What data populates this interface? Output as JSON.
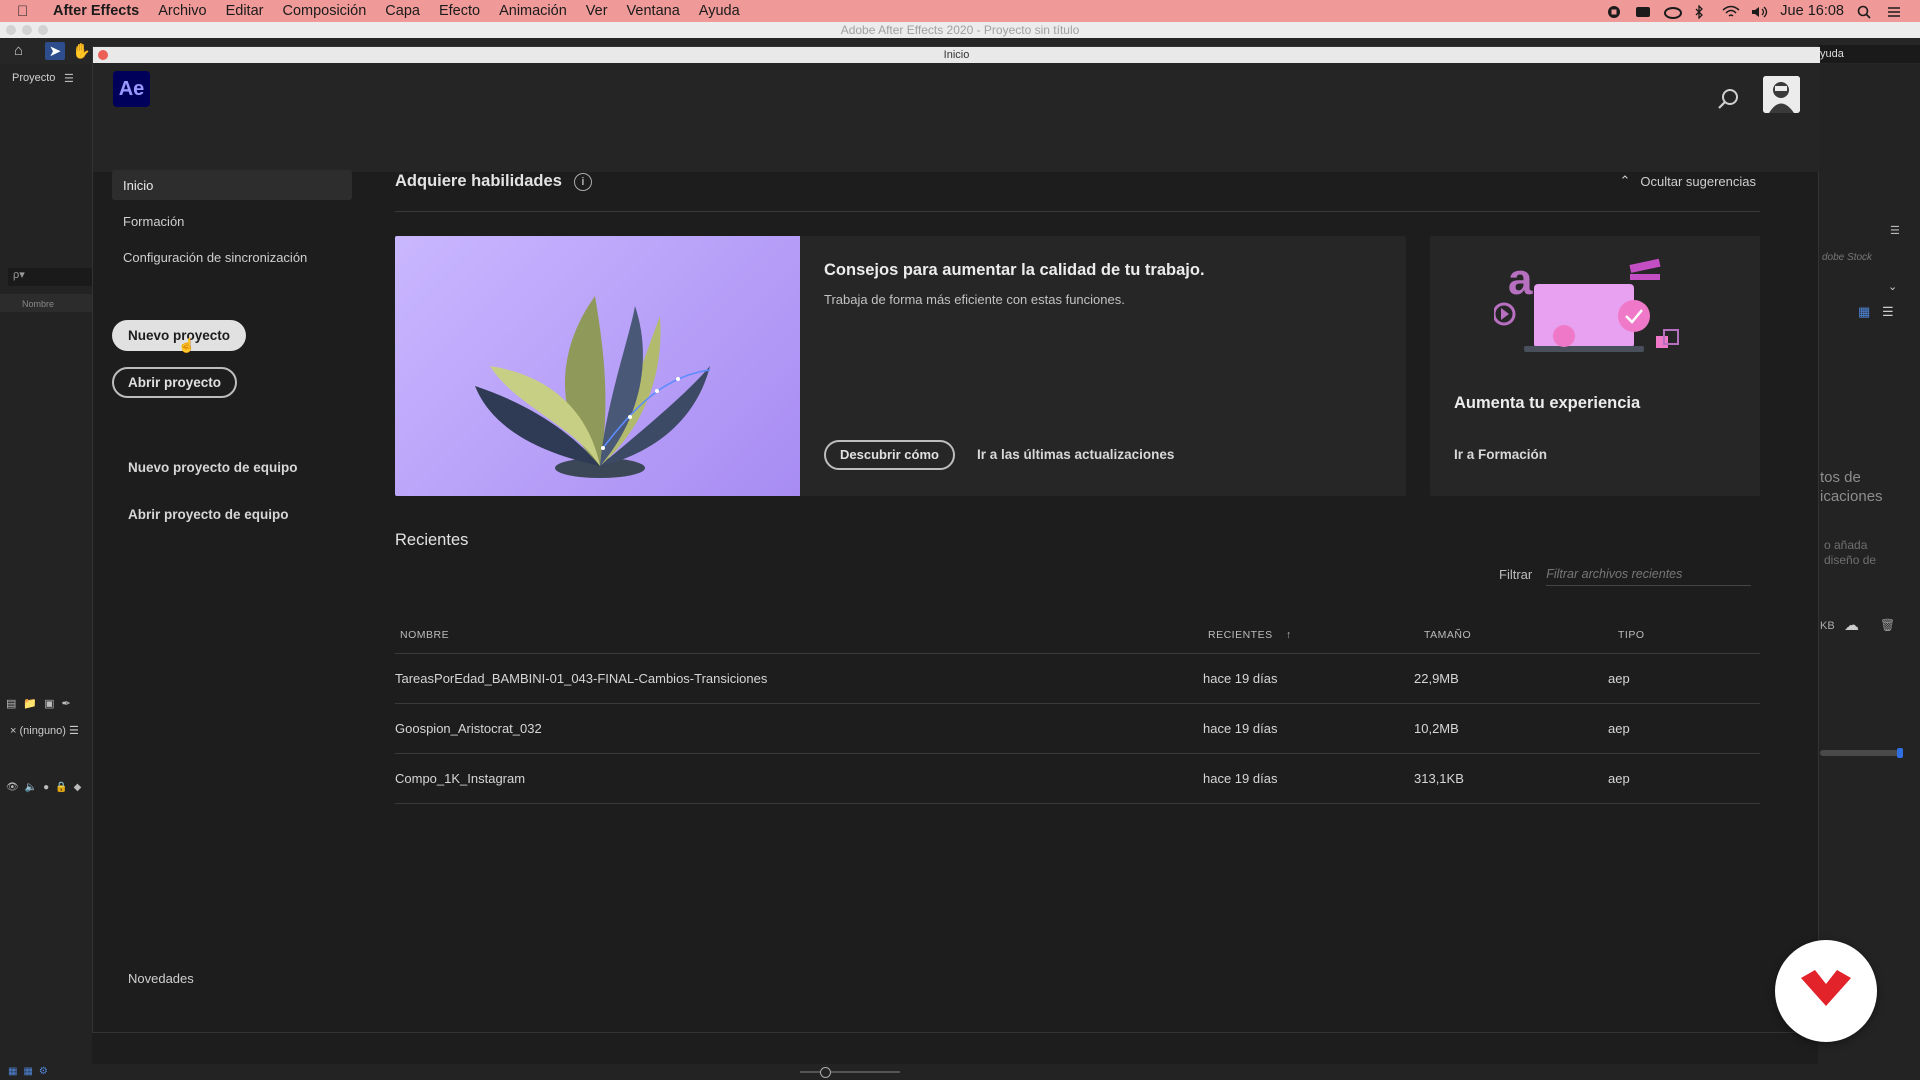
{
  "menubar": {
    "app_name": "After Effects",
    "items": [
      "Archivo",
      "Editar",
      "Composición",
      "Capa",
      "Efecto",
      "Animación",
      "Ver",
      "Ventana",
      "Ayuda"
    ],
    "clock": "Jue 16:08"
  },
  "window_title": "Adobe After Effects 2020 - Proyecto sin título",
  "background": {
    "project_panel_title": "Proyecto",
    "search_placeholder": "ρ▾",
    "name_column": "Nombre",
    "none_label": "(ninguno)",
    "help_tab": "yuda",
    "stock_label": "dobe Stock",
    "right_text_1": "tos de\nicaciones",
    "right_text_2": "o añada\ndiseño de",
    "kb_label": "KB"
  },
  "home": {
    "window_title": "Inicio",
    "logo_text": "Ae",
    "nav": [
      "Inicio",
      "Formación",
      "Configuración de sincronización"
    ],
    "new_project": "Nuevo proyecto",
    "open_project": "Abrir proyecto",
    "new_team_project": "Nuevo proyecto de equipo",
    "open_team_project": "Abrir proyecto de equipo",
    "whats_new": "Novedades"
  },
  "skills": {
    "title": "Adquiere habilidades",
    "hide_label": "Ocultar sugerencias",
    "card1": {
      "title": "Consejos para aumentar la calidad de tu trabajo.",
      "description": "Trabaja de forma más eficiente con estas funciones.",
      "button": "Descubrir cómo",
      "link": "Ir a las últimas actualizaciones"
    },
    "card2": {
      "title": "Aumenta tu experiencia",
      "link": "Ir a Formación"
    }
  },
  "recent": {
    "title": "Recientes",
    "filter_label": "Filtrar",
    "filter_placeholder": "Filtrar archivos recientes",
    "columns": [
      "NOMBRE",
      "RECIENTES",
      "TAMAÑO",
      "TIPO"
    ],
    "sort_indicator": "↑",
    "rows": [
      {
        "name": "TareasPorEdad_BAMBINI-01_043-FINAL-Cambios-Transiciones",
        "recent": "hace 19 días",
        "size": "22,9MB",
        "type": "aep"
      },
      {
        "name": "Goospion_Aristocrat_032",
        "recent": "hace 19 días",
        "size": "10,2MB",
        "type": "aep"
      },
      {
        "name": "Compo_1K_Instagram",
        "recent": "hace 19 días",
        "size": "313,1KB",
        "type": "aep"
      }
    ]
  },
  "colors": {
    "menubar": "#ef9a98",
    "ae_logo_bg": "#00005b",
    "ae_logo_text": "#9999ff",
    "card_art": "#b49cf7",
    "badge_red": "#e2232a"
  }
}
